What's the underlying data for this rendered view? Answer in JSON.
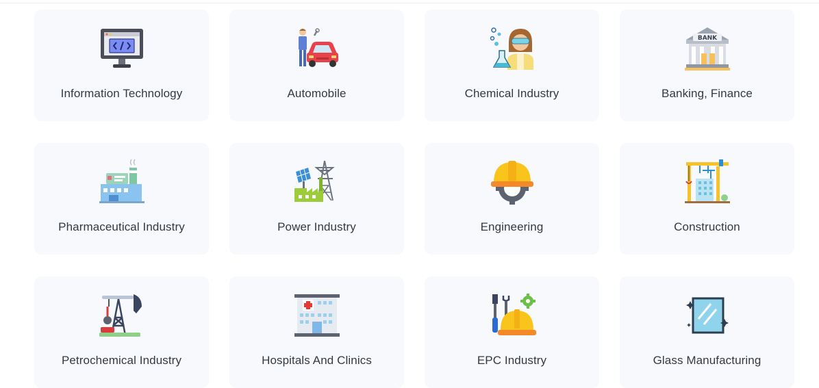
{
  "industries": [
    {
      "label": "Information Technology",
      "icon": "computer-code-icon"
    },
    {
      "label": "Automobile",
      "icon": "mechanic-car-icon"
    },
    {
      "label": "Chemical Industry",
      "icon": "chemist-icon"
    },
    {
      "label": "Banking, Finance",
      "icon": "bank-icon",
      "icon_text": "BANK"
    },
    {
      "label": "Pharmaceutical Industry",
      "icon": "pharma-factory-icon"
    },
    {
      "label": "Power Industry",
      "icon": "power-plant-icon"
    },
    {
      "label": "Engineering",
      "icon": "hardhat-gear-icon"
    },
    {
      "label": "Construction",
      "icon": "crane-building-icon"
    },
    {
      "label": "Petrochemical Industry",
      "icon": "oil-pump-icon"
    },
    {
      "label": "Hospitals And Clinics",
      "icon": "hospital-icon"
    },
    {
      "label": "EPC Industry",
      "icon": "tools-hardhat-icon"
    },
    {
      "label": "Glass Manufacturing",
      "icon": "glass-pane-icon"
    }
  ]
}
